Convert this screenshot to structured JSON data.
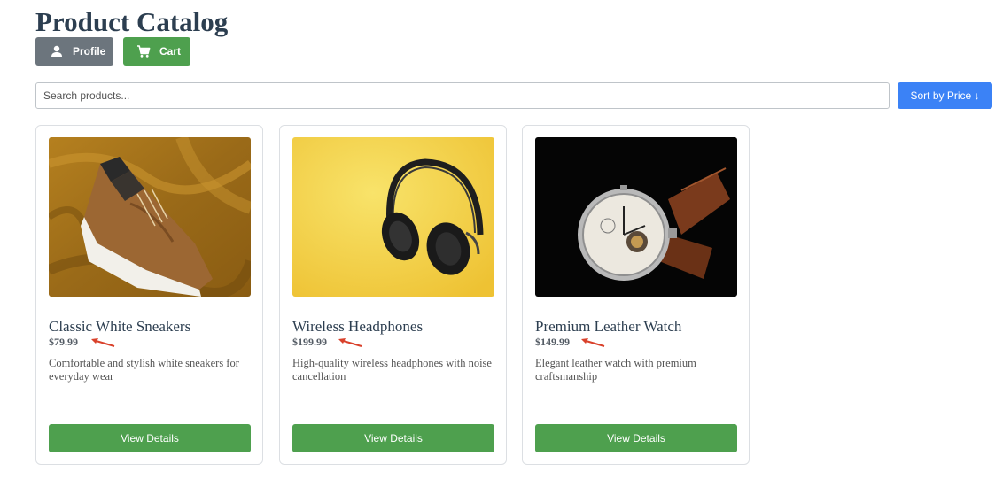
{
  "page": {
    "title": "Product Catalog"
  },
  "nav": {
    "profile_label": "Profile",
    "profile_icon": "person-icon",
    "cart_label": "Cart",
    "cart_icon": "cart-icon"
  },
  "search": {
    "placeholder": "Search products...",
    "value": ""
  },
  "sort": {
    "label": "Sort by Price ↓"
  },
  "products": [
    {
      "name": "Classic White Sneakers",
      "price": "$79.99",
      "description": "Comfortable and stylish white sneakers for everyday wear",
      "button_label": "View Details",
      "image": "sneaker-photo"
    },
    {
      "name": "Wireless Headphones",
      "price": "$199.99",
      "description": "High-quality wireless headphones with noise cancellation",
      "button_label": "View Details",
      "image": "headphones-photo"
    },
    {
      "name": "Premium Leather Watch",
      "price": "$149.99",
      "description": "Elegant leather watch with premium craftsmanship",
      "button_label": "View Details",
      "image": "watch-photo"
    }
  ],
  "annotations": {
    "price_arrow_color": "#d9412b"
  },
  "colors": {
    "title": "#2c3e50",
    "profile_button": "#6c757d",
    "success_green": "#4ea04e",
    "primary_blue": "#3b82f6"
  }
}
